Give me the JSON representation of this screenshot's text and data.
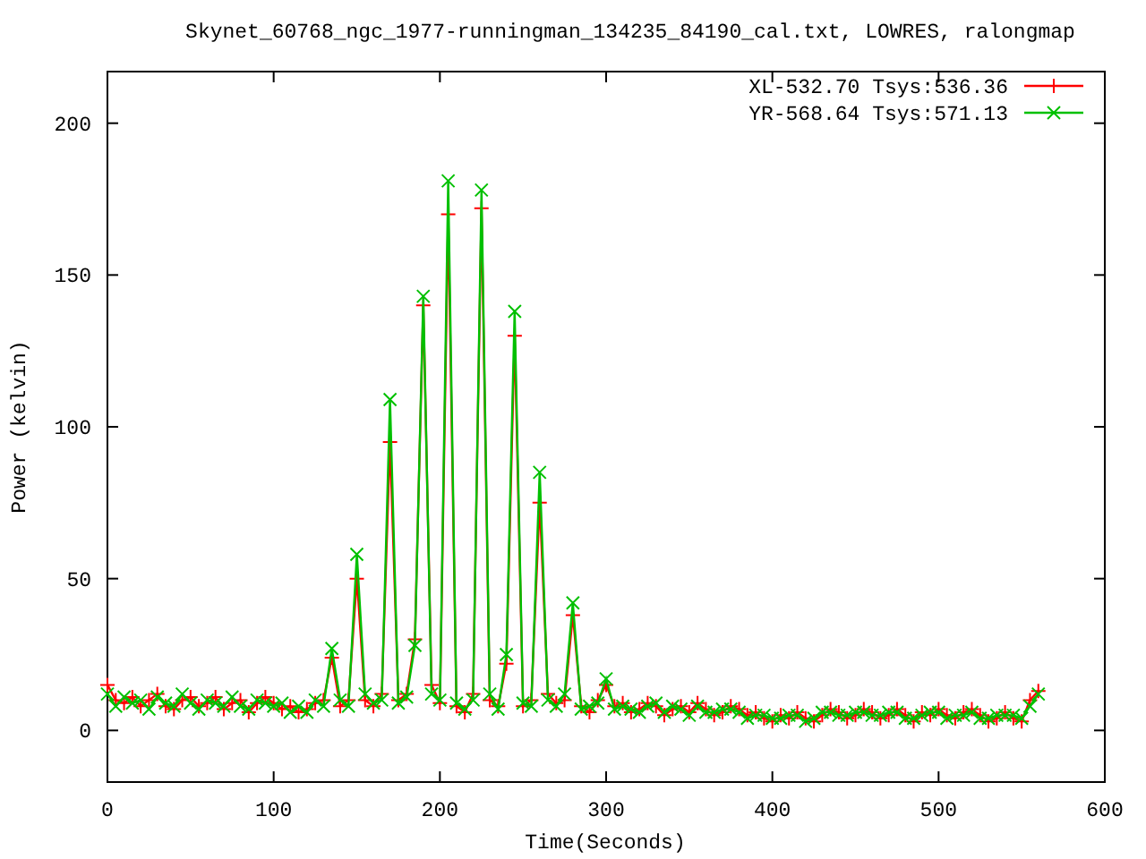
{
  "chart_data": {
    "type": "line",
    "title": "Skynet_60768_ngc_1977-runningman_134235_84190_cal.txt, LOWRES, ralongmap",
    "xlabel": "Time(Seconds)",
    "ylabel": "Power (kelvin)",
    "x": [
      0,
      5,
      10,
      15,
      20,
      25,
      30,
      35,
      40,
      45,
      50,
      55,
      60,
      65,
      70,
      75,
      80,
      85,
      90,
      95,
      100,
      105,
      110,
      115,
      120,
      125,
      130,
      135,
      140,
      145,
      150,
      155,
      160,
      165,
      170,
      175,
      180,
      185,
      190,
      195,
      200,
      205,
      210,
      215,
      220,
      225,
      230,
      235,
      240,
      245,
      250,
      255,
      260,
      265,
      270,
      275,
      280,
      285,
      290,
      295,
      300,
      305,
      310,
      315,
      320,
      325,
      330,
      335,
      340,
      345,
      350,
      355,
      360,
      365,
      370,
      375,
      380,
      385,
      390,
      395,
      400,
      405,
      410,
      415,
      420,
      425,
      430,
      435,
      440,
      445,
      450,
      455,
      460,
      465,
      470,
      475,
      480,
      485,
      490,
      495,
      500,
      505,
      510,
      515,
      520,
      525,
      530,
      535,
      540,
      545,
      550,
      555,
      560
    ],
    "series": [
      {
        "name": "XL-532.70 Tsys:536.36",
        "color": "#ff0000",
        "marker": "plus",
        "values": [
          15,
          10,
          9,
          11,
          8,
          10,
          12,
          8,
          7,
          10,
          11,
          8,
          9,
          11,
          7,
          9,
          10,
          6,
          9,
          11,
          9,
          7,
          8,
          6,
          7,
          9,
          10,
          24,
          8,
          10,
          50,
          10,
          8,
          12,
          95,
          10,
          12,
          30,
          140,
          15,
          9,
          170,
          8,
          6,
          12,
          172,
          10,
          8,
          22,
          130,
          8,
          10,
          75,
          12,
          9,
          10,
          38,
          8,
          6,
          10,
          15,
          8,
          9,
          6,
          7,
          9,
          8,
          5,
          7,
          8,
          6,
          9,
          7,
          5,
          6,
          8,
          7,
          5,
          6,
          4,
          3,
          5,
          4,
          6,
          4,
          3,
          5,
          7,
          6,
          4,
          5,
          7,
          6,
          4,
          5,
          7,
          5,
          3,
          6,
          5,
          7,
          5,
          4,
          6,
          7,
          5,
          3,
          4,
          6,
          4,
          3,
          10,
          13
        ]
      },
      {
        "name": "YR-568.64 Tsys:571.13",
        "color": "#00c000",
        "marker": "x",
        "values": [
          12,
          8,
          11,
          9,
          10,
          7,
          11,
          9,
          8,
          12,
          9,
          7,
          10,
          9,
          8,
          11,
          8,
          7,
          10,
          9,
          8,
          9,
          6,
          8,
          6,
          10,
          8,
          27,
          10,
          8,
          58,
          12,
          9,
          10,
          109,
          9,
          11,
          28,
          143,
          12,
          10,
          181,
          9,
          7,
          10,
          178,
          12,
          7,
          25,
          138,
          9,
          8,
          85,
          10,
          8,
          12,
          42,
          7,
          8,
          9,
          17,
          7,
          8,
          7,
          6,
          8,
          9,
          6,
          8,
          7,
          5,
          8,
          6,
          6,
          7,
          7,
          6,
          4,
          5,
          5,
          4,
          4,
          5,
          5,
          3,
          4,
          6,
          6,
          5,
          5,
          6,
          6,
          5,
          5,
          6,
          6,
          4,
          4,
          5,
          6,
          6,
          4,
          5,
          5,
          6,
          4,
          4,
          5,
          5,
          5,
          4,
          8,
          12
        ]
      }
    ],
    "legend": true,
    "xlim": [
      0,
      600
    ],
    "ylim": [
      -17,
      217
    ],
    "xticks": [
      0,
      100,
      200,
      300,
      400,
      500,
      600
    ],
    "yticks": [
      0,
      50,
      100,
      150,
      200
    ]
  }
}
